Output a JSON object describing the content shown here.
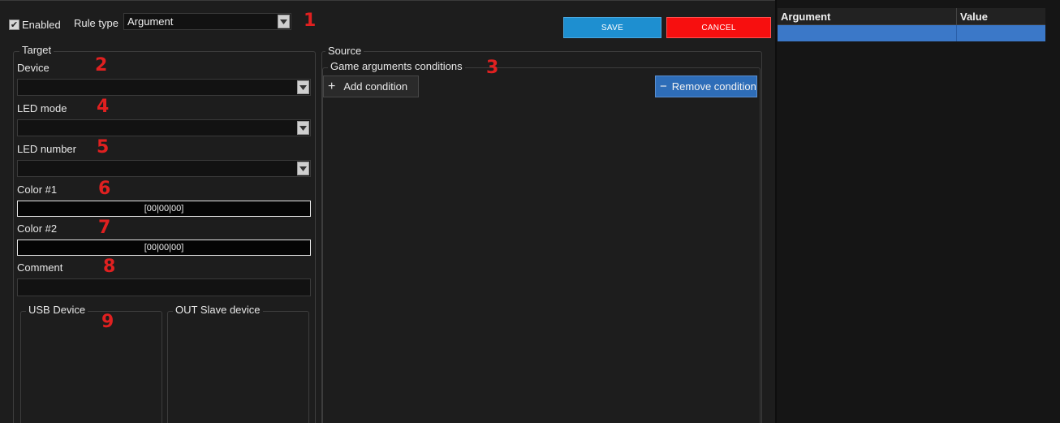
{
  "header": {
    "enabled_label": "Enabled",
    "enabled_checked": true,
    "rule_type_label": "Rule type",
    "rule_type_value": "Argument",
    "save_label": "SAVE",
    "cancel_label": "CANCEL"
  },
  "target": {
    "title": "Target",
    "device_label": "Device",
    "device_value": "",
    "led_mode_label": "LED mode",
    "led_mode_value": "",
    "led_number_label": "LED number",
    "led_number_value": "",
    "color1_label": "Color #1",
    "color1_value": "[00|00|00]",
    "color2_label": "Color #2",
    "color2_value": "[00|00|00]",
    "comment_label": "Comment",
    "comment_value": "",
    "usb_device_title": "USB Device",
    "out_slave_title": "OUT Slave device"
  },
  "source": {
    "title": "Source",
    "conditions_title": "Game arguments conditions",
    "add_condition_label": "Add condition",
    "remove_condition_label": "Remove condition"
  },
  "table": {
    "columns": [
      "Argument",
      "Value"
    ],
    "rows": [
      [
        "",
        ""
      ]
    ]
  },
  "annotations": [
    "1",
    "2",
    "3",
    "4",
    "5",
    "6",
    "7",
    "8",
    "9"
  ],
  "colors": {
    "save": "#1e8fd0",
    "cancel": "#f70f0f",
    "accent_blue": "#2e6db8",
    "selection": "#3b78c8",
    "annotation": "#e02020"
  },
  "icons": {
    "checkbox_mark": "✔",
    "add": "+",
    "remove": "−"
  }
}
